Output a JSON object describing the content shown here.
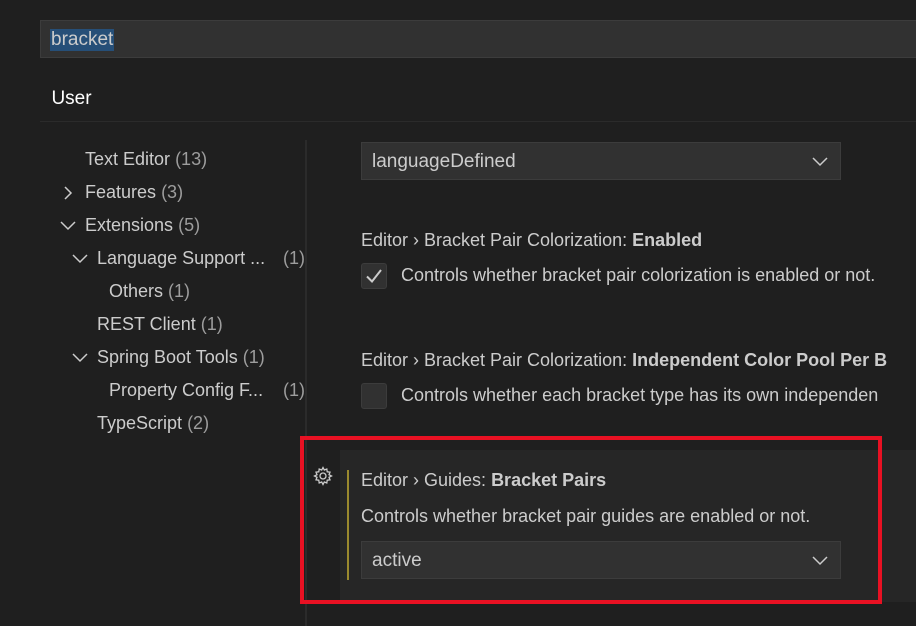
{
  "search": {
    "value": "bracket"
  },
  "tabs": [
    {
      "label": "User"
    }
  ],
  "toc": {
    "items": [
      {
        "label": "Text Editor",
        "count": "(13)"
      },
      {
        "label": "Features",
        "count": "(3)"
      },
      {
        "label": "Extensions",
        "count": "(5)"
      },
      {
        "label": "Language Support ...",
        "count": "(1)"
      },
      {
        "label": "Others",
        "count": "(1)"
      },
      {
        "label": "REST Client",
        "count": "(1)"
      },
      {
        "label": "Spring Boot Tools",
        "count": "(1)"
      },
      {
        "label": "Property Config F...",
        "count": "(1)"
      },
      {
        "label": "TypeScript",
        "count": "(2)"
      }
    ]
  },
  "settings": {
    "top_dropdown_value": "languageDefined",
    "colorization_enabled": {
      "category": "Editor › Bracket Pair Colorization: ",
      "name": "Enabled",
      "description": "Controls whether bracket pair colorization is enabled or not.",
      "checked": true
    },
    "independent_pool": {
      "category": "Editor › Bracket Pair Colorization: ",
      "name": "Independent Color Pool Per B",
      "description": "Controls whether each bracket type has its own independen",
      "checked": false
    },
    "guides_bracket_pairs": {
      "category": "Editor › Guides: ",
      "name": "Bracket Pairs",
      "description": "Controls whether bracket pair guides are enabled or not.",
      "value": "active"
    }
  },
  "colors": {
    "highlight": "#e81123",
    "focus_bar": "#9b8a2e",
    "background": "#1f1f1f"
  }
}
